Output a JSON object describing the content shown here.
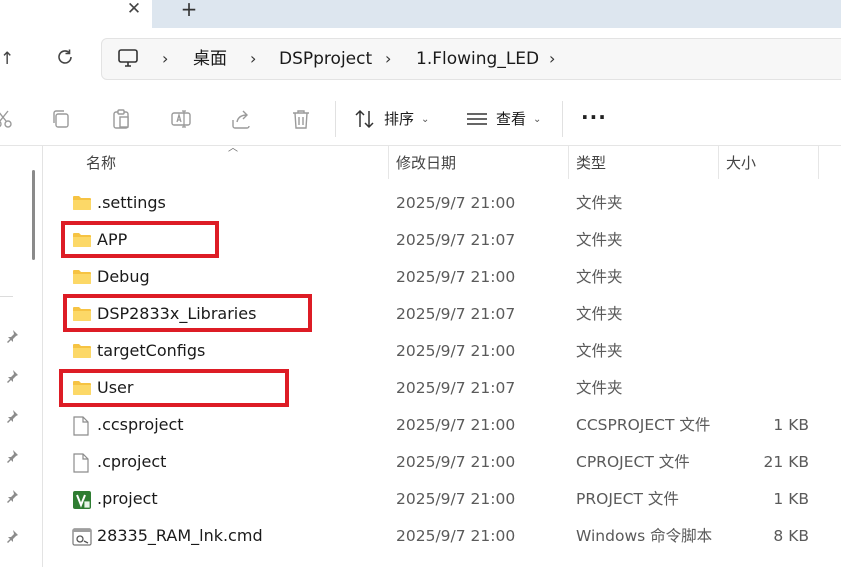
{
  "tabs": {
    "close_glyph": "✕",
    "new_tab_glyph": "+"
  },
  "address": {
    "breadcrumbs": [
      "桌面",
      "DSPproject",
      "1.Flowing_LED"
    ],
    "separator": "›"
  },
  "commands": {
    "sort_label": "排序",
    "view_label": "查看",
    "more_glyph": "···"
  },
  "columns": {
    "name": "名称",
    "modified": "修改日期",
    "type": "类型",
    "size": "大小"
  },
  "files": [
    {
      "name": ".settings",
      "modified": "2025/9/7 21:00",
      "type": "文件夹",
      "size": "",
      "icon": "folder-icon"
    },
    {
      "name": "APP",
      "modified": "2025/9/7 21:07",
      "type": "文件夹",
      "size": "",
      "icon": "folder-icon"
    },
    {
      "name": "Debug",
      "modified": "2025/9/7 21:00",
      "type": "文件夹",
      "size": "",
      "icon": "folder-icon"
    },
    {
      "name": "DSP2833x_Libraries",
      "modified": "2025/9/7 21:07",
      "type": "文件夹",
      "size": "",
      "icon": "folder-icon"
    },
    {
      "name": "targetConfigs",
      "modified": "2025/9/7 21:00",
      "type": "文件夹",
      "size": "",
      "icon": "folder-icon"
    },
    {
      "name": "User",
      "modified": "2025/9/7 21:07",
      "type": "文件夹",
      "size": "",
      "icon": "folder-icon"
    },
    {
      "name": ".ccsproject",
      "modified": "2025/9/7 21:00",
      "type": "CCSPROJECT 文件",
      "size": "1 KB",
      "icon": "file-icon"
    },
    {
      "name": ".cproject",
      "modified": "2025/9/7 21:00",
      "type": "CPROJECT 文件",
      "size": "21 KB",
      "icon": "file-icon"
    },
    {
      "name": ".project",
      "modified": "2025/9/7 21:00",
      "type": "PROJECT 文件",
      "size": "1 KB",
      "icon": "eclipse-project-icon"
    },
    {
      "name": "28335_RAM_lnk.cmd",
      "modified": "2025/9/7 21:00",
      "type": "Windows 命令脚本",
      "size": "8 KB",
      "icon": "cmd-script-icon"
    }
  ],
  "colors": {
    "highlight_box": "#dd1c25",
    "folder": "#f6c343",
    "accent": "#0067c0"
  }
}
